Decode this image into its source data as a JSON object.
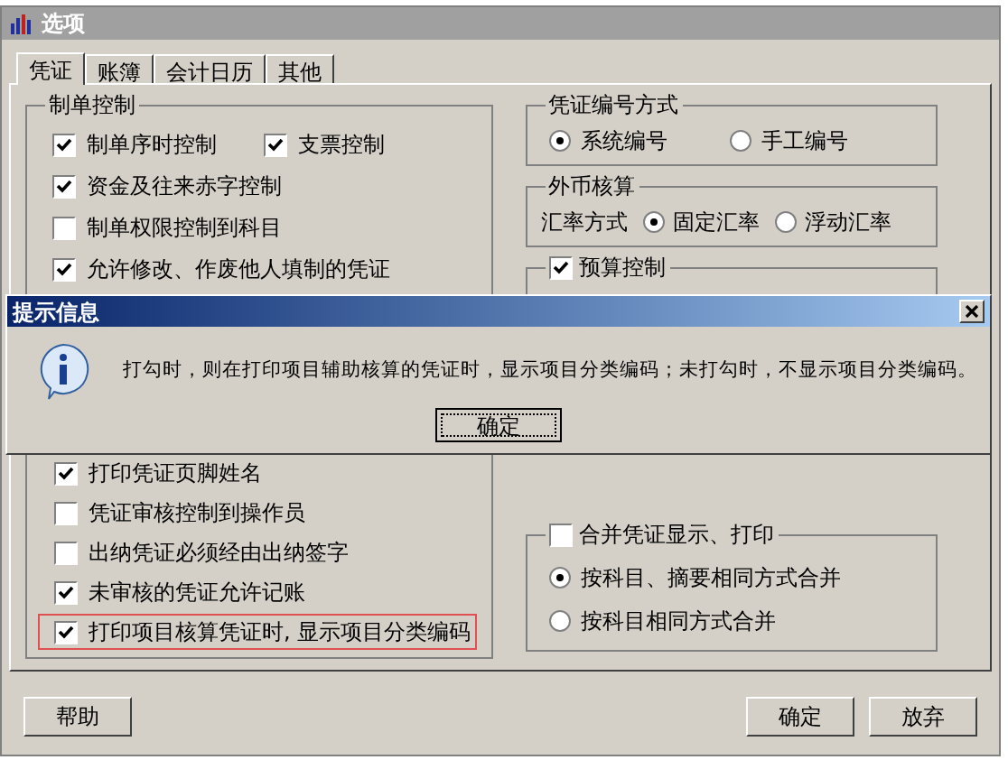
{
  "window": {
    "title": "选项"
  },
  "tabs": [
    {
      "label": "凭证",
      "selected": true
    },
    {
      "label": "账簿",
      "selected": false
    },
    {
      "label": "会计日历",
      "selected": false
    },
    {
      "label": "其他",
      "selected": false
    }
  ],
  "voucher_control": {
    "title": "制单控制",
    "top_rows": [
      [
        {
          "label": "制单序时控制",
          "checked": true
        },
        {
          "label": "支票控制",
          "checked": true
        }
      ],
      [
        {
          "label": "资金及往来赤字控制",
          "checked": true
        }
      ],
      [
        {
          "label": "制单权限控制到科目",
          "checked": false
        }
      ],
      [
        {
          "label": "允许修改、作废他人填制的凭证",
          "checked": true
        }
      ]
    ],
    "bottom_options": [
      {
        "label": "打印凭证页脚姓名",
        "checked": true,
        "highlighted": false
      },
      {
        "label": "凭证审核控制到操作员",
        "checked": false,
        "highlighted": false
      },
      {
        "label": "出纳凭证必须经由出纳签字",
        "checked": false,
        "highlighted": false
      },
      {
        "label": "未审核的凭证允许记账",
        "checked": true,
        "highlighted": false
      },
      {
        "label": "打印项目核算凭证时, 显示项目分类编码",
        "checked": true,
        "highlighted": true
      }
    ]
  },
  "numbering": {
    "title": "凭证编号方式",
    "options": [
      {
        "label": "系统编号",
        "selected": true
      },
      {
        "label": "手工编号",
        "selected": false
      }
    ]
  },
  "foreign_currency": {
    "title": "外币核算",
    "rate_label": "汇率方式",
    "options": [
      {
        "label": "固定汇率",
        "selected": true
      },
      {
        "label": "浮动汇率",
        "selected": false
      }
    ]
  },
  "budget_control": {
    "label": "预算控制",
    "checked": true
  },
  "merge": {
    "label": "合并凭证显示、打印",
    "checked": false,
    "options": [
      {
        "label": "按科目、摘要相同方式合并",
        "selected": true
      },
      {
        "label": "按科目相同方式合并",
        "selected": false
      }
    ]
  },
  "help_button": "帮助",
  "action_buttons": [
    "确定",
    "放弃"
  ],
  "dialog": {
    "title": "提示信息",
    "message": "打勾时，则在打印项目辅助核算的凭证时，显示项目分类编码；未打勾时，不显示项目分类编码。",
    "button": "确定"
  }
}
